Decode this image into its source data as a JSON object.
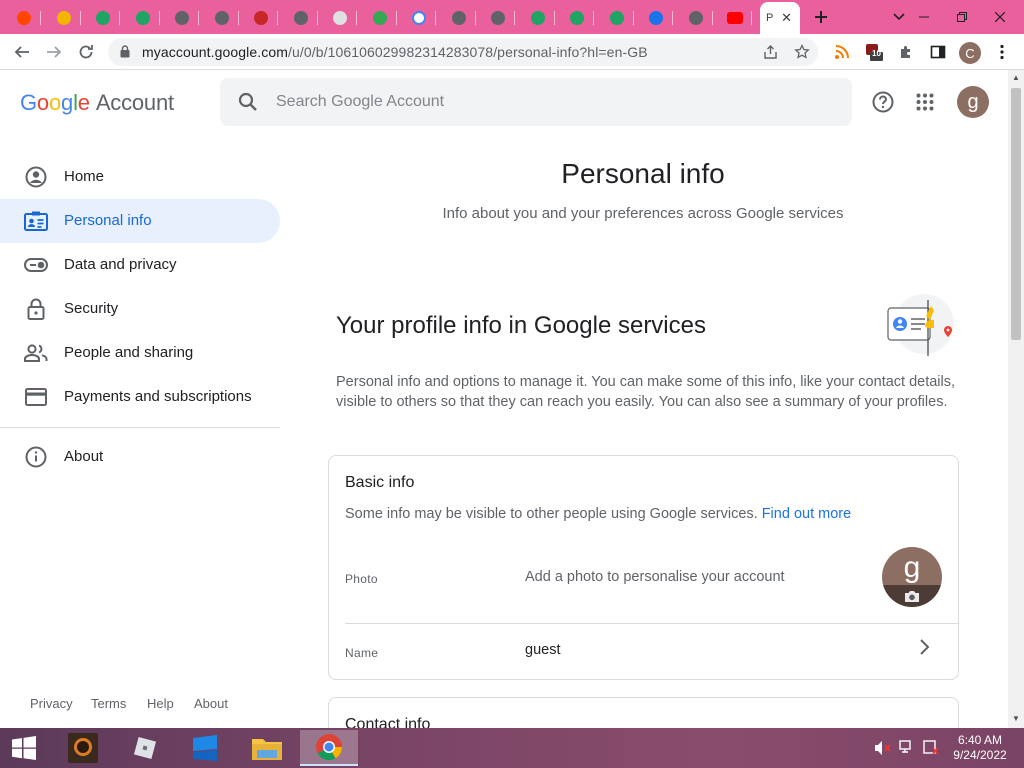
{
  "browser": {
    "tabs": [
      {
        "icon": "reddit-icon",
        "color": "#ff4500"
      },
      {
        "icon": "pinwheel-icon",
        "color": "#f4b400"
      },
      {
        "icon": "drive-icon",
        "color": "#1fa463"
      },
      {
        "icon": "drive-icon",
        "color": "#1fa463"
      },
      {
        "icon": "globe-icon",
        "color": "#5f6368"
      },
      {
        "icon": "globe-icon",
        "color": "#5f6368"
      },
      {
        "icon": "airplane-icon",
        "color": "#c62828"
      },
      {
        "icon": "globe-icon",
        "color": "#5f6368"
      },
      {
        "icon": "image-icon",
        "color": "#e0e0e0"
      },
      {
        "icon": "colorful-icon",
        "color": "#34a853"
      },
      {
        "icon": "google-icon",
        "color": "#ffffff"
      },
      {
        "icon": "settings-icon",
        "color": "#5f6368"
      },
      {
        "icon": "chrome-icon",
        "color": "#5f6368"
      },
      {
        "icon": "drive-icon",
        "color": "#1fa463"
      },
      {
        "icon": "drive-icon",
        "color": "#1fa463"
      },
      {
        "icon": "drive-icon",
        "color": "#1fa463"
      },
      {
        "icon": "account-icon",
        "color": "#1a73e8"
      },
      {
        "icon": "chrome-icon",
        "color": "#5f6368"
      },
      {
        "icon": "youtube-icon",
        "color": "#ff0000"
      }
    ],
    "active_tab_letter": "P",
    "url_host": "myaccount.google.com",
    "url_path": "/u/0/b/106106029982314283078/personal-info?hl=en-GB",
    "extension_badge": "10",
    "profile_initial": "C"
  },
  "header": {
    "logo_letters": [
      "G",
      "o",
      "o",
      "g",
      "l",
      "e"
    ],
    "logo_suffix": "Account",
    "search_placeholder": "Search Google Account",
    "avatar_initial": "g"
  },
  "sidebar": {
    "items": [
      {
        "label": "Home",
        "icon": "account-circle-icon"
      },
      {
        "label": "Personal info",
        "icon": "id-card-icon"
      },
      {
        "label": "Data and privacy",
        "icon": "toggle-icon"
      },
      {
        "label": "Security",
        "icon": "lock-icon"
      },
      {
        "label": "People and sharing",
        "icon": "people-icon"
      },
      {
        "label": "Payments and subscriptions",
        "icon": "credit-card-icon"
      }
    ],
    "about": {
      "label": "About",
      "icon": "info-icon"
    },
    "footer": [
      "Privacy",
      "Terms",
      "Help",
      "About"
    ]
  },
  "main": {
    "title": "Personal info",
    "subtitle": "Info about you and your preferences across Google services",
    "section_title": "Your profile info in Google services",
    "section_desc": "Personal info and options to manage it. You can make some of this info, like your contact details, visible to others so that they can reach you easily. You can also see a summary of your profiles.",
    "basic_info": {
      "title": "Basic info",
      "desc": "Some info may be visible to other people using Google services.",
      "link": "Find out more",
      "photo_label": "Photo",
      "photo_value": "Add a photo to personalise your account",
      "photo_initial": "g",
      "name_label": "Name",
      "name_value": "guest"
    },
    "contact_info": {
      "title": "Contact info"
    }
  },
  "taskbar": {
    "time": "6:40 AM",
    "date": "9/24/2022"
  }
}
